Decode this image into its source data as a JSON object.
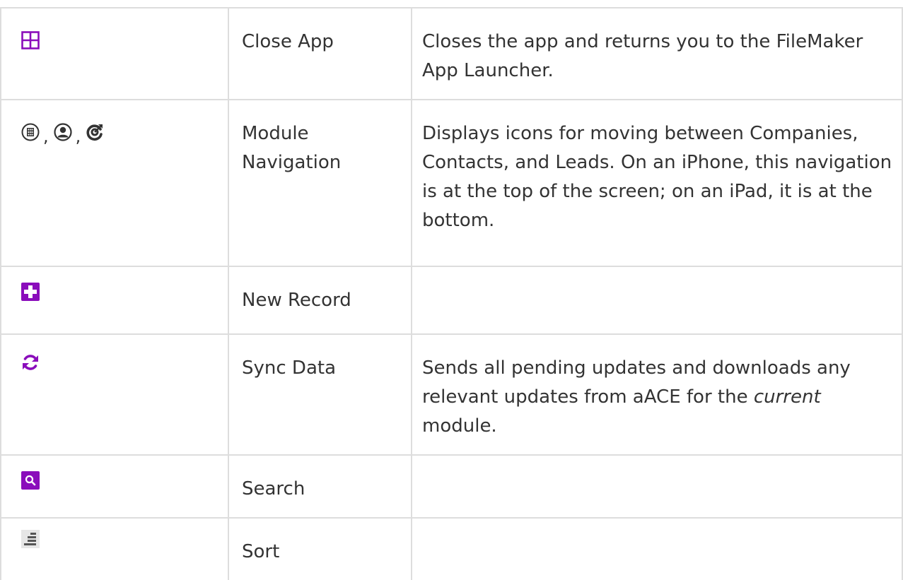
{
  "colors": {
    "accent": "#8a0dbb",
    "text": "#333333",
    "border": "#dddddd",
    "sort_icon": "#555555",
    "sort_bg": "#e6e6e6"
  },
  "rows": [
    {
      "icon": "close-app-icon",
      "name": "Close App",
      "desc": "Closes the app and returns you to the FileMaker App Launcher."
    },
    {
      "icons": [
        "companies-icon",
        "contacts-icon",
        "leads-icon"
      ],
      "separator": ",",
      "name_lines": [
        "Module",
        "Navigation"
      ],
      "desc": "Displays icons for moving between Companies, Contacts, and Leads. On an iPhone, this navigation is at the top of the screen; on an iPad, it is at the bottom."
    },
    {
      "icon": "new-record-icon",
      "name": "New Record",
      "desc": ""
    },
    {
      "icon": "sync-data-icon",
      "name": "Sync Data",
      "desc_before": "Sends all pending updates and downloads any relevant updates from aACE for the ",
      "desc_em": "current",
      "desc_after": " module."
    },
    {
      "icon": "search-icon",
      "name": "Search",
      "desc": ""
    },
    {
      "icon": "sort-icon",
      "name": "Sort",
      "desc": ""
    }
  ]
}
